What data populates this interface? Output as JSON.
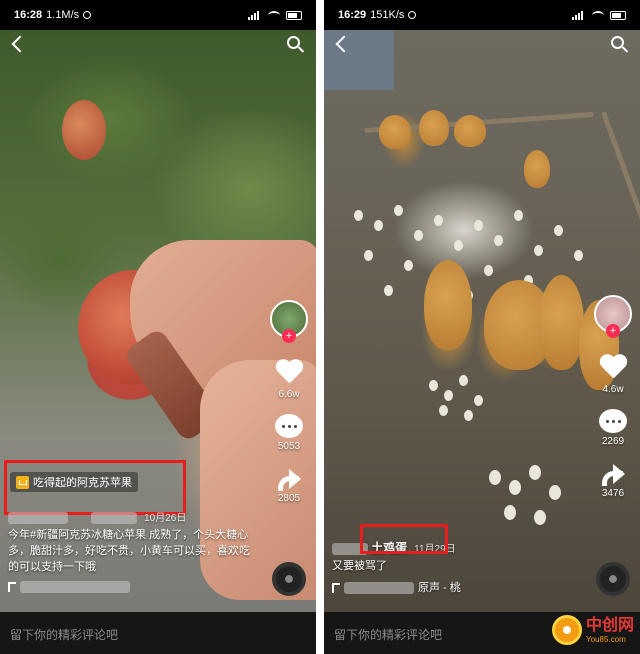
{
  "left": {
    "status_bar": {
      "time": "16:28",
      "speed": "1.1M/s"
    },
    "product_tag": "吃得起的阿克苏苹果",
    "stats": {
      "likes": "6.6w",
      "comments": "5053",
      "shares": "2805"
    },
    "caption": {
      "date": "10月26日",
      "text": "今年#新疆阿克苏冰糖心苹果 成熟了，个头大糖心多，脆甜汁多，好吃不贵，小黄车可以买，喜欢吃的可以支持一下哦"
    },
    "comment_placeholder": "留下你的精彩评论吧"
  },
  "right": {
    "status_bar": {
      "time": "16:29",
      "speed": "151K/s"
    },
    "stats": {
      "likes": "4.6w",
      "comments": "2269",
      "shares": "3476"
    },
    "caption": {
      "title": "土鸡蛋",
      "date": "11月29日",
      "text": "又要被骂了",
      "music": "原声 - 桃"
    },
    "comment_placeholder": "留下你的精彩评论吧"
  },
  "watermark": {
    "title": "中创网",
    "sub": "You85.com"
  },
  "colors": {
    "highlight": "#e61e1e",
    "like_red": "#fe2c55",
    "cart_yellow": "#f6b21b"
  }
}
